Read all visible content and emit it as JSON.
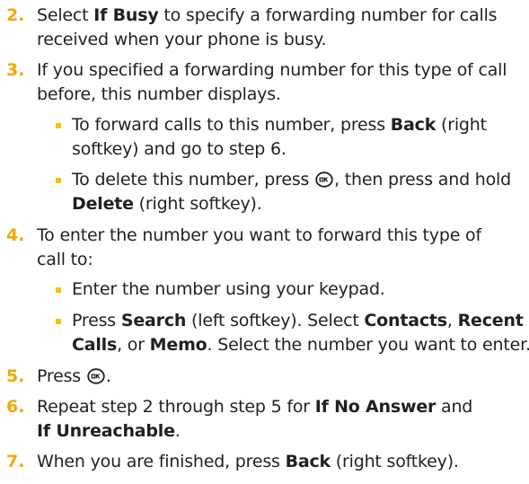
{
  "steps": {
    "s2": {
      "num": "2.",
      "l1a": "Select ",
      "l1b": "If Busy",
      "l1c": " to specify a forwarding number for calls",
      "l2": "received when your phone is busy."
    },
    "s3": {
      "num": "3.",
      "l1": "If you specified a forwarding number for this type of call",
      "l2": "before, this number displays.",
      "b1": {
        "l1a": "To forward calls to this number, press ",
        "l1b": "Back",
        "l1c": " (right",
        "l2": "softkey) and go to step 6."
      },
      "b2": {
        "l1a": "To delete this number, press ",
        "l1b": ", then press and hold",
        "l2a": "Delete",
        "l2b": " (right softkey)."
      }
    },
    "s4": {
      "num": "4.",
      "l1": "To enter the number you want to forward this type of",
      "l2": "call to:",
      "b1": {
        "l1": "Enter the number using your keypad."
      },
      "b2": {
        "l1a": "Press ",
        "l1b": "Search",
        "l1c": " (left softkey). Select ",
        "l1d": "Contacts",
        "l1e": ", ",
        "l1f": "Recent",
        "l2a": "Calls",
        "l2b": ", or ",
        "l2c": "Memo",
        "l2d": ". Select the number you want to enter."
      }
    },
    "s5": {
      "num": "5.",
      "l1a": "Press ",
      "l1b": "."
    },
    "s6": {
      "num": "6.",
      "l1a": "Repeat step 2 through step 5 for ",
      "l1b": "If No Answer",
      "l1c": " and",
      "l2a": "If Unreachable",
      "l2b": "."
    },
    "s7": {
      "num": "7.",
      "l1a": "When you are finished, press ",
      "l1b": "Back",
      "l1c": " (right softkey)."
    }
  },
  "icons": {
    "ok_key": "ok-key-icon"
  },
  "colors": {
    "step_number": "#f2a900",
    "bullet": "#f7c200",
    "text": "#231f20"
  }
}
